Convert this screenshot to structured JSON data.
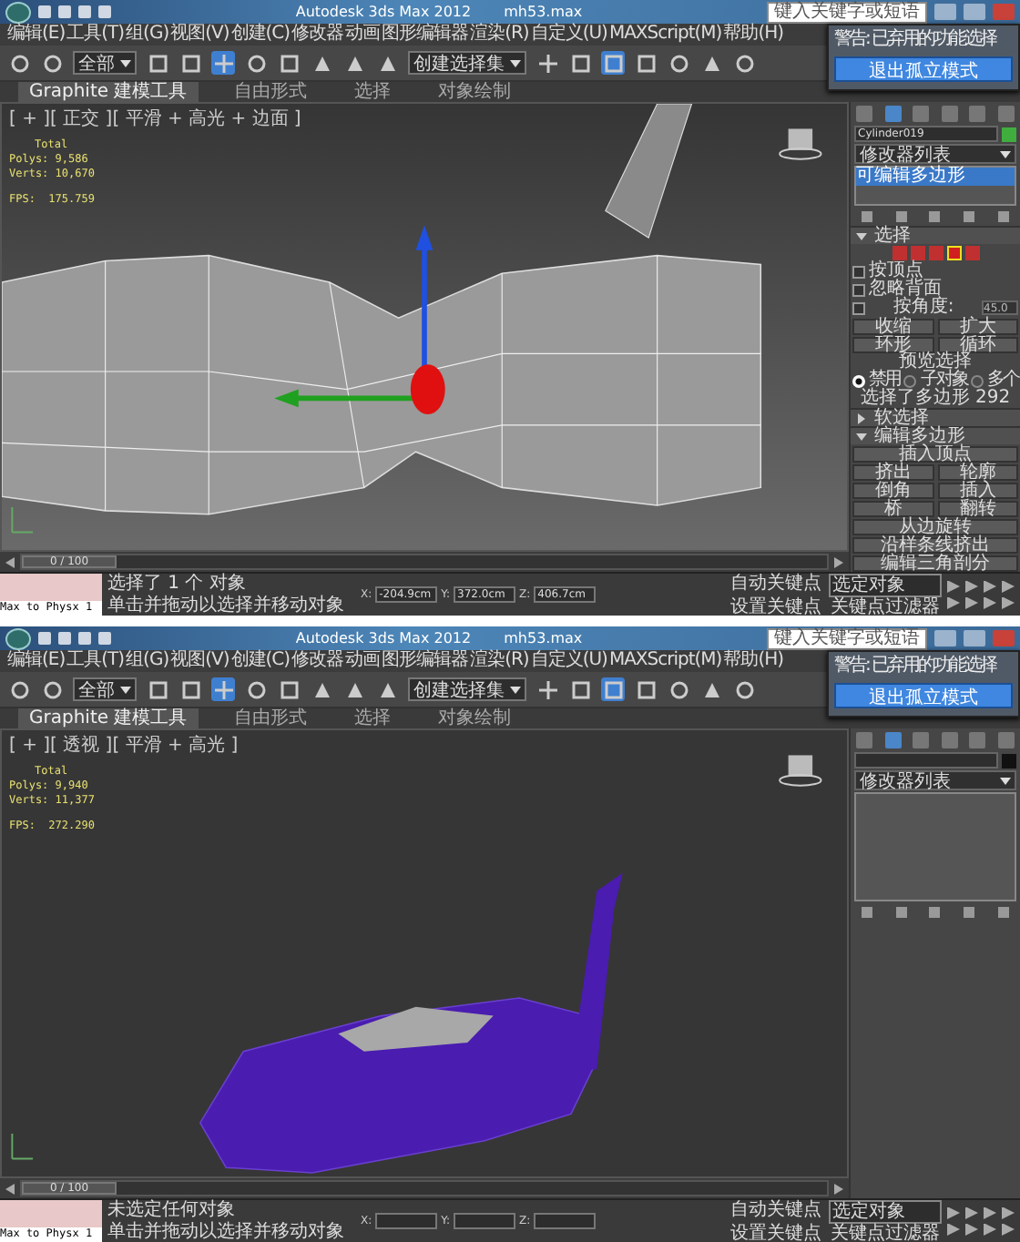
{
  "screens": [
    {
      "title": "Autodesk 3ds Max  2012",
      "file": "mh53.max",
      "search": {
        "placeholder": "键入关键字或短语"
      },
      "menus": [
        "编辑(E)",
        "工具(T)",
        "组(G)",
        "视图(V)",
        "创建(C)",
        "修改器",
        "动画",
        "图形编辑器",
        "渲染(R)",
        "自定义(U)",
        "MAXScript(M)",
        "帮助(H)"
      ],
      "selection_filter": "全部",
      "named_selection": "创建选择集",
      "ribbon_tabs": [
        {
          "label": "Graphite 建模工具",
          "selected": true
        },
        {
          "label": "自由形式",
          "selected": false
        },
        {
          "label": "选择",
          "selected": false
        },
        {
          "label": "对象绘制",
          "selected": false
        }
      ],
      "popup": {
        "title": "警告: 已弃用的功能选择",
        "button": "退出孤立模式"
      },
      "viewport": {
        "label": "[ + ][ 正交 ][ 平滑 + 高光 + 边面 ]",
        "kind": "mesh",
        "stats": [
          "Total",
          "Polys: 9,586",
          "Verts: 10,670",
          "FPS:  175.759"
        ]
      },
      "panel": {
        "tabs": [
          {
            "selected": false
          },
          {
            "selected": true
          },
          {
            "selected": false
          },
          {
            "selected": false
          },
          {
            "selected": false
          },
          {
            "selected": false
          }
        ],
        "object_name": "Cylinder019",
        "modifier_list": "修改器列表",
        "stack": [
          "可编辑多边形"
        ],
        "rollout": [
          {
            "kind": "header",
            "label": "选择",
            "expanded": true
          },
          {
            "kind": "subobjects",
            "items": [
              {
                "selected": false
              },
              {
                "selected": false
              },
              {
                "selected": false
              },
              {
                "selected": true
              },
              {
                "selected": false
              }
            ]
          },
          {
            "kind": "checkbox",
            "label": "按顶点",
            "checked": false
          },
          {
            "kind": "checkbox",
            "label": "忽略背面",
            "checked": false
          },
          {
            "kind": "spinner",
            "label": "按角度:",
            "value": "45.0",
            "checked": false
          },
          {
            "kind": "buttons",
            "labels": [
              "收缩",
              "扩大"
            ]
          },
          {
            "kind": "buttons",
            "labels": [
              "环形",
              "循环"
            ]
          },
          {
            "kind": "text",
            "text": "预览选择"
          },
          {
            "kind": "radios",
            "options": [
              {
                "label": "禁用",
                "selected": true
              },
              {
                "label": "子对象",
                "selected": false
              },
              {
                "label": "多个",
                "selected": false
              }
            ]
          },
          {
            "kind": "text",
            "text": "选择了多边形 292"
          },
          {
            "kind": "header",
            "label": "软选择",
            "expanded": false
          },
          {
            "kind": "header",
            "label": "编辑多边形",
            "expanded": true
          },
          {
            "kind": "buttons",
            "labels": [
              "插入顶点"
            ]
          },
          {
            "kind": "buttons",
            "labels": [
              "挤出",
              "轮廓"
            ]
          },
          {
            "kind": "buttons",
            "labels": [
              "倒角",
              "插入"
            ]
          },
          {
            "kind": "buttons",
            "labels": [
              "桥",
              "翻转"
            ]
          },
          {
            "kind": "buttons",
            "labels": [
              "从边旋转"
            ]
          },
          {
            "kind": "buttons",
            "labels": [
              "沿样条线挤出"
            ]
          },
          {
            "kind": "buttons",
            "labels": [
              "编辑三角剖分"
            ]
          }
        ]
      },
      "timeline": {
        "label": "0 / 100"
      },
      "status": {
        "physx": "Max to Physx 1",
        "message": "选择了 1 个 对象",
        "prompt": "单击并拖动以选择并移动对象",
        "coords": [
          {
            "axis": "X:",
            "value": "-204.9cm"
          },
          {
            "axis": "Y:",
            "value": "372.0cm"
          },
          {
            "axis": "Z:",
            "value": "406.7cm"
          }
        ],
        "auto_key": "自动关键点",
        "key_mode": "选定对象",
        "set_key": "设置关键点",
        "key_filters": "关键点过滤器"
      }
    },
    {
      "title": "Autodesk 3ds Max  2012",
      "file": "mh53.max",
      "search": {
        "placeholder": "键入关键字或短语"
      },
      "menus": [
        "编辑(E)",
        "工具(T)",
        "组(G)",
        "视图(V)",
        "创建(C)",
        "修改器",
        "动画",
        "图形编辑器",
        "渲染(R)",
        "自定义(U)",
        "MAXScript(M)",
        "帮助(H)"
      ],
      "selection_filter": "全部",
      "named_selection": "创建选择集",
      "ribbon_tabs": [
        {
          "label": "Graphite 建模工具",
          "selected": true
        },
        {
          "label": "自由形式",
          "selected": false
        },
        {
          "label": "选择",
          "selected": false
        },
        {
          "label": "对象绘制",
          "selected": false
        }
      ],
      "popup": {
        "title": "警告: 已弃用的功能选择",
        "button": "退出孤立模式"
      },
      "viewport": {
        "label": "[ + ][ 透视 ][ 平滑 + 高光 ]",
        "kind": "helicopter",
        "stats": [
          "Total",
          "Polys: 9,940",
          "Verts: 11,377",
          "FPS:  272.290"
        ]
      },
      "panel": {
        "tabs": [
          {
            "selected": false
          },
          {
            "selected": true
          },
          {
            "selected": false
          },
          {
            "selected": false
          },
          {
            "selected": false
          },
          {
            "selected": false
          }
        ],
        "modifier_list": "修改器列表"
      },
      "timeline": {
        "label": "0 / 100"
      },
      "status": {
        "physx": "Max to Physx 1",
        "message": "未选定任何对象",
        "prompt": "单击并拖动以选择并移动对象",
        "coords": [
          {
            "axis": "X:"
          },
          {
            "axis": "Y:"
          },
          {
            "axis": "Z:"
          }
        ],
        "auto_key": "自动关键点",
        "key_mode": "选定对象",
        "set_key": "设置关键点",
        "key_filters": "关键点过滤器"
      }
    }
  ]
}
